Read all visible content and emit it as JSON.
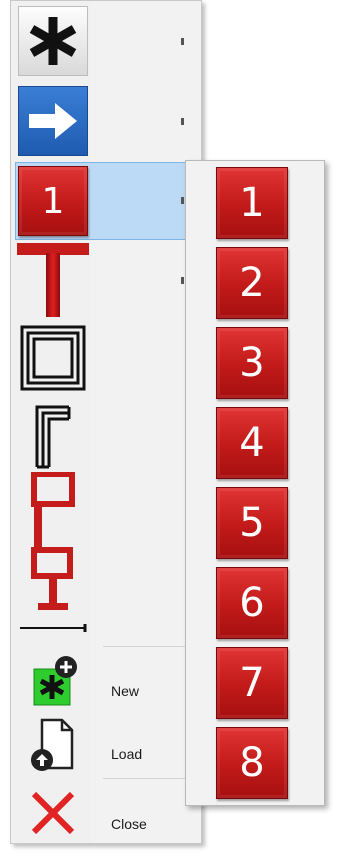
{
  "menu": {
    "items": [
      {
        "name": "asterisk-tool",
        "icon": "asterisk-icon"
      },
      {
        "name": "arrow-tool",
        "icon": "arrow-right-icon"
      },
      {
        "name": "number-tool",
        "icon": "number-icon",
        "number": "1"
      },
      {
        "name": "t-shape-tool",
        "icon": "t-shape-icon"
      },
      {
        "name": "double-square-tool",
        "icon": "double-square-icon"
      },
      {
        "name": "corner-tool",
        "icon": "corner-icon"
      },
      {
        "name": "flag-tool",
        "icon": "flag-icon"
      },
      {
        "name": "pin-tool",
        "icon": "pin-icon"
      },
      {
        "name": "line-tool",
        "icon": "line-icon"
      }
    ],
    "new_label": "New",
    "load_label": "Load",
    "close_label": "Close"
  },
  "submenu": {
    "numbers": [
      "1",
      "2",
      "3",
      "4",
      "5",
      "6",
      "7",
      "8"
    ]
  },
  "colors": {
    "red": "#c41b1b",
    "blue": "#1e5bb0",
    "highlight": "#bcd9f5",
    "green": "#2ecc2e"
  }
}
